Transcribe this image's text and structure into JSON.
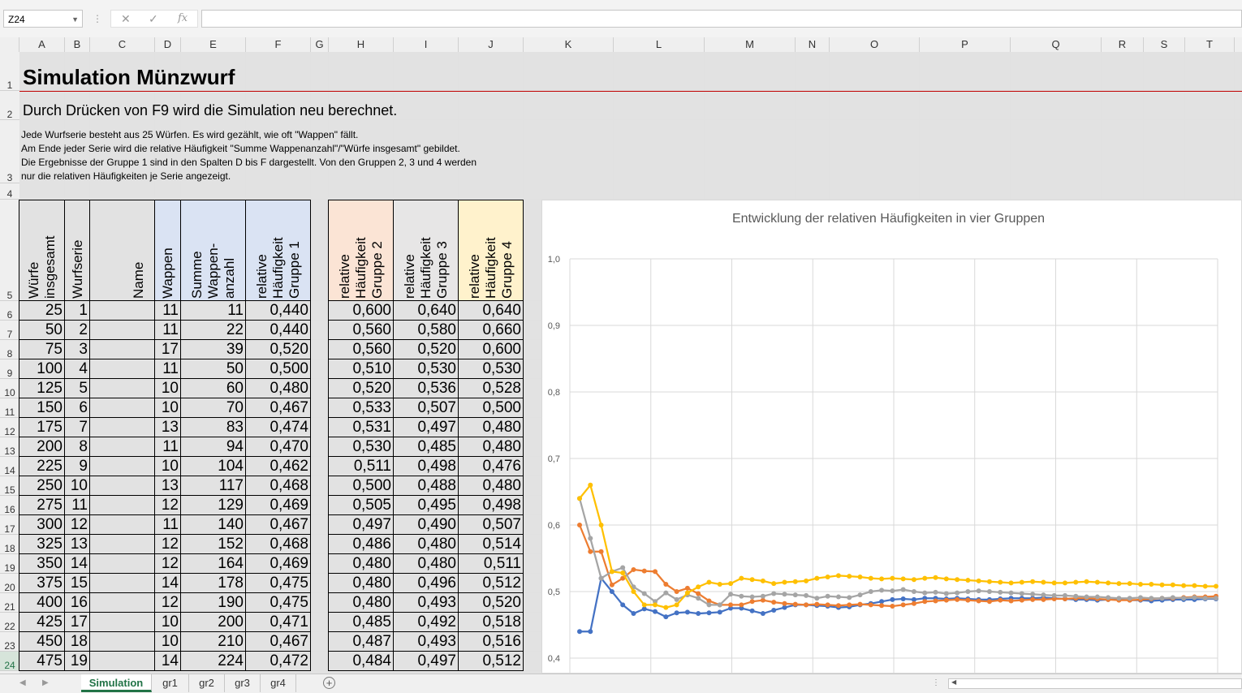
{
  "formula_bar": {
    "name_box": "Z24",
    "cancel_icon": "✕",
    "enter_icon": "✓",
    "fx_label": "fx",
    "formula": ""
  },
  "columns": [
    "A",
    "B",
    "C",
    "D",
    "E",
    "F",
    "G",
    "H",
    "I",
    "J",
    "K",
    "L",
    "M",
    "N",
    "O",
    "P",
    "Q",
    "R",
    "S",
    "T"
  ],
  "rows": [
    "1",
    "2",
    "3",
    "4",
    "5",
    "6",
    "7",
    "8",
    "9",
    "10",
    "11",
    "12",
    "13",
    "14",
    "15",
    "16",
    "17",
    "18",
    "19",
    "20",
    "21",
    "22",
    "23",
    "24"
  ],
  "selected_row": "24",
  "title": "Simulation Münzwurf",
  "subtitle": "Durch Drücken von F9 wird die Simulation neu berechnet.",
  "description": [
    "Jede Wurfserie besteht aus 25 Würfen. Es wird gezählt, wie oft \"Wappen\" fällt.",
    "Am Ende jeder Serie wird die relative Häufigkeit \"Summe Wappenanzahl\"/\"Würfe insgesamt\" gebildet.",
    "Die Ergebnisse der Gruppe 1 sind in den Spalten D bis F dargestellt. Von den Gruppen 2, 3 und 4 werden",
    "nur die relativen Häufigkeiten je Serie angezeigt."
  ],
  "headers": {
    "A": [
      "Würfe",
      "insgesamt"
    ],
    "B": [
      "Wurfserie"
    ],
    "C": [
      "Name"
    ],
    "D": [
      "Wappen"
    ],
    "E": [
      "Summe",
      "Wappen-",
      "anzahl"
    ],
    "F": [
      "relative",
      "Häufigkeit",
      "Gruppe 1"
    ],
    "H": [
      "relative",
      "Häufigkeit",
      "Gruppe 2"
    ],
    "I": [
      "relative",
      "Häufigkeit",
      "Gruppe 3"
    ],
    "J": [
      "relative",
      "Häufigkeit",
      "Gruppe 4"
    ]
  },
  "header_colors": {
    "group1": "#dae3f3",
    "group2": "#fbe4d5",
    "group3": "#e7e6e6",
    "group4": "#fff2cc"
  },
  "table": [
    [
      "25",
      "1",
      "",
      "11",
      "11",
      "0,440",
      "0,600",
      "0,640",
      "0,640"
    ],
    [
      "50",
      "2",
      "",
      "11",
      "22",
      "0,440",
      "0,560",
      "0,580",
      "0,660"
    ],
    [
      "75",
      "3",
      "",
      "17",
      "39",
      "0,520",
      "0,560",
      "0,520",
      "0,600"
    ],
    [
      "100",
      "4",
      "",
      "11",
      "50",
      "0,500",
      "0,510",
      "0,530",
      "0,530"
    ],
    [
      "125",
      "5",
      "",
      "10",
      "60",
      "0,480",
      "0,520",
      "0,536",
      "0,528"
    ],
    [
      "150",
      "6",
      "",
      "10",
      "70",
      "0,467",
      "0,533",
      "0,507",
      "0,500"
    ],
    [
      "175",
      "7",
      "",
      "13",
      "83",
      "0,474",
      "0,531",
      "0,497",
      "0,480"
    ],
    [
      "200",
      "8",
      "",
      "11",
      "94",
      "0,470",
      "0,530",
      "0,485",
      "0,480"
    ],
    [
      "225",
      "9",
      "",
      "10",
      "104",
      "0,462",
      "0,511",
      "0,498",
      "0,476"
    ],
    [
      "250",
      "10",
      "",
      "13",
      "117",
      "0,468",
      "0,500",
      "0,488",
      "0,480"
    ],
    [
      "275",
      "11",
      "",
      "12",
      "129",
      "0,469",
      "0,505",
      "0,495",
      "0,498"
    ],
    [
      "300",
      "12",
      "",
      "11",
      "140",
      "0,467",
      "0,497",
      "0,490",
      "0,507"
    ],
    [
      "325",
      "13",
      "",
      "12",
      "152",
      "0,468",
      "0,486",
      "0,480",
      "0,514"
    ],
    [
      "350",
      "14",
      "",
      "12",
      "164",
      "0,469",
      "0,480",
      "0,480",
      "0,511"
    ],
    [
      "375",
      "15",
      "",
      "14",
      "178",
      "0,475",
      "0,480",
      "0,496",
      "0,512"
    ],
    [
      "400",
      "16",
      "",
      "12",
      "190",
      "0,475",
      "0,480",
      "0,493",
      "0,520"
    ],
    [
      "425",
      "17",
      "",
      "10",
      "200",
      "0,471",
      "0,485",
      "0,492",
      "0,518"
    ],
    [
      "450",
      "18",
      "",
      "10",
      "210",
      "0,467",
      "0,487",
      "0,493",
      "0,516"
    ],
    [
      "475",
      "19",
      "",
      "14",
      "224",
      "0,472",
      "0,484",
      "0,497",
      "0,512"
    ]
  ],
  "chart_data": {
    "type": "line",
    "title": "Entwicklung der relativen Häufigkeiten in vier Gruppen",
    "ylim": [
      0.4,
      1.0
    ],
    "yticks": [
      "1,0",
      "0,9",
      "0,8",
      "0,7",
      "0,6",
      "0,5",
      "0,4"
    ],
    "grid": true,
    "series": [
      {
        "color": "#4472c4",
        "values": [
          0.44,
          0.44,
          0.52,
          0.5,
          0.48,
          0.467,
          0.474,
          0.47,
          0.462,
          0.468,
          0.469,
          0.467,
          0.468,
          0.469,
          0.475,
          0.475,
          0.471,
          0.467,
          0.472,
          0.476,
          0.48,
          0.48,
          0.479,
          0.478,
          0.476,
          0.477,
          0.48,
          0.482,
          0.485,
          0.488,
          0.489,
          0.488,
          0.49,
          0.49,
          0.489,
          0.49,
          0.489,
          0.488,
          0.488,
          0.489,
          0.49,
          0.49,
          0.49,
          0.491,
          0.49,
          0.489,
          0.488,
          0.488,
          0.487,
          0.488,
          0.488,
          0.487,
          0.487,
          0.486,
          0.487,
          0.488,
          0.488,
          0.488,
          0.489,
          0.489
        ]
      },
      {
        "color": "#ed7d31",
        "values": [
          0.6,
          0.56,
          0.56,
          0.51,
          0.52,
          0.533,
          0.531,
          0.53,
          0.511,
          0.5,
          0.505,
          0.497,
          0.486,
          0.48,
          0.48,
          0.48,
          0.485,
          0.487,
          0.484,
          0.482,
          0.481,
          0.48,
          0.481,
          0.48,
          0.479,
          0.48,
          0.481,
          0.48,
          0.479,
          0.478,
          0.48,
          0.482,
          0.485,
          0.486,
          0.487,
          0.488,
          0.487,
          0.486,
          0.485,
          0.487,
          0.486,
          0.487,
          0.488,
          0.488,
          0.489,
          0.489,
          0.49,
          0.49,
          0.489,
          0.488,
          0.487,
          0.487,
          0.488,
          0.489,
          0.49,
          0.49,
          0.491,
          0.492,
          0.492,
          0.493
        ]
      },
      {
        "color": "#a5a5a5",
        "values": [
          0.64,
          0.58,
          0.52,
          0.53,
          0.536,
          0.507,
          0.497,
          0.485,
          0.498,
          0.488,
          0.495,
          0.49,
          0.48,
          0.48,
          0.496,
          0.493,
          0.492,
          0.493,
          0.497,
          0.496,
          0.495,
          0.494,
          0.49,
          0.493,
          0.492,
          0.491,
          0.495,
          0.5,
          0.502,
          0.501,
          0.503,
          0.5,
          0.498,
          0.499,
          0.497,
          0.498,
          0.5,
          0.501,
          0.5,
          0.499,
          0.498,
          0.497,
          0.496,
          0.495,
          0.494,
          0.494,
          0.493,
          0.492,
          0.492,
          0.491,
          0.49,
          0.49,
          0.491,
          0.49,
          0.49,
          0.491,
          0.49,
          0.491,
          0.49,
          0.49
        ]
      },
      {
        "color": "#ffc000",
        "values": [
          0.64,
          0.66,
          0.6,
          0.53,
          0.528,
          0.5,
          0.48,
          0.48,
          0.476,
          0.48,
          0.498,
          0.507,
          0.514,
          0.511,
          0.512,
          0.52,
          0.518,
          0.516,
          0.512,
          0.514,
          0.515,
          0.516,
          0.52,
          0.522,
          0.524,
          0.523,
          0.522,
          0.52,
          0.519,
          0.52,
          0.519,
          0.518,
          0.52,
          0.521,
          0.519,
          0.518,
          0.517,
          0.516,
          0.515,
          0.514,
          0.513,
          0.514,
          0.515,
          0.514,
          0.513,
          0.513,
          0.514,
          0.515,
          0.514,
          0.513,
          0.512,
          0.512,
          0.511,
          0.511,
          0.51,
          0.51,
          0.509,
          0.509,
          0.508,
          0.508
        ]
      }
    ]
  },
  "sheet_tabs": [
    "Simulation",
    "gr1",
    "gr2",
    "gr3",
    "gr4"
  ],
  "active_tab": "Simulation"
}
